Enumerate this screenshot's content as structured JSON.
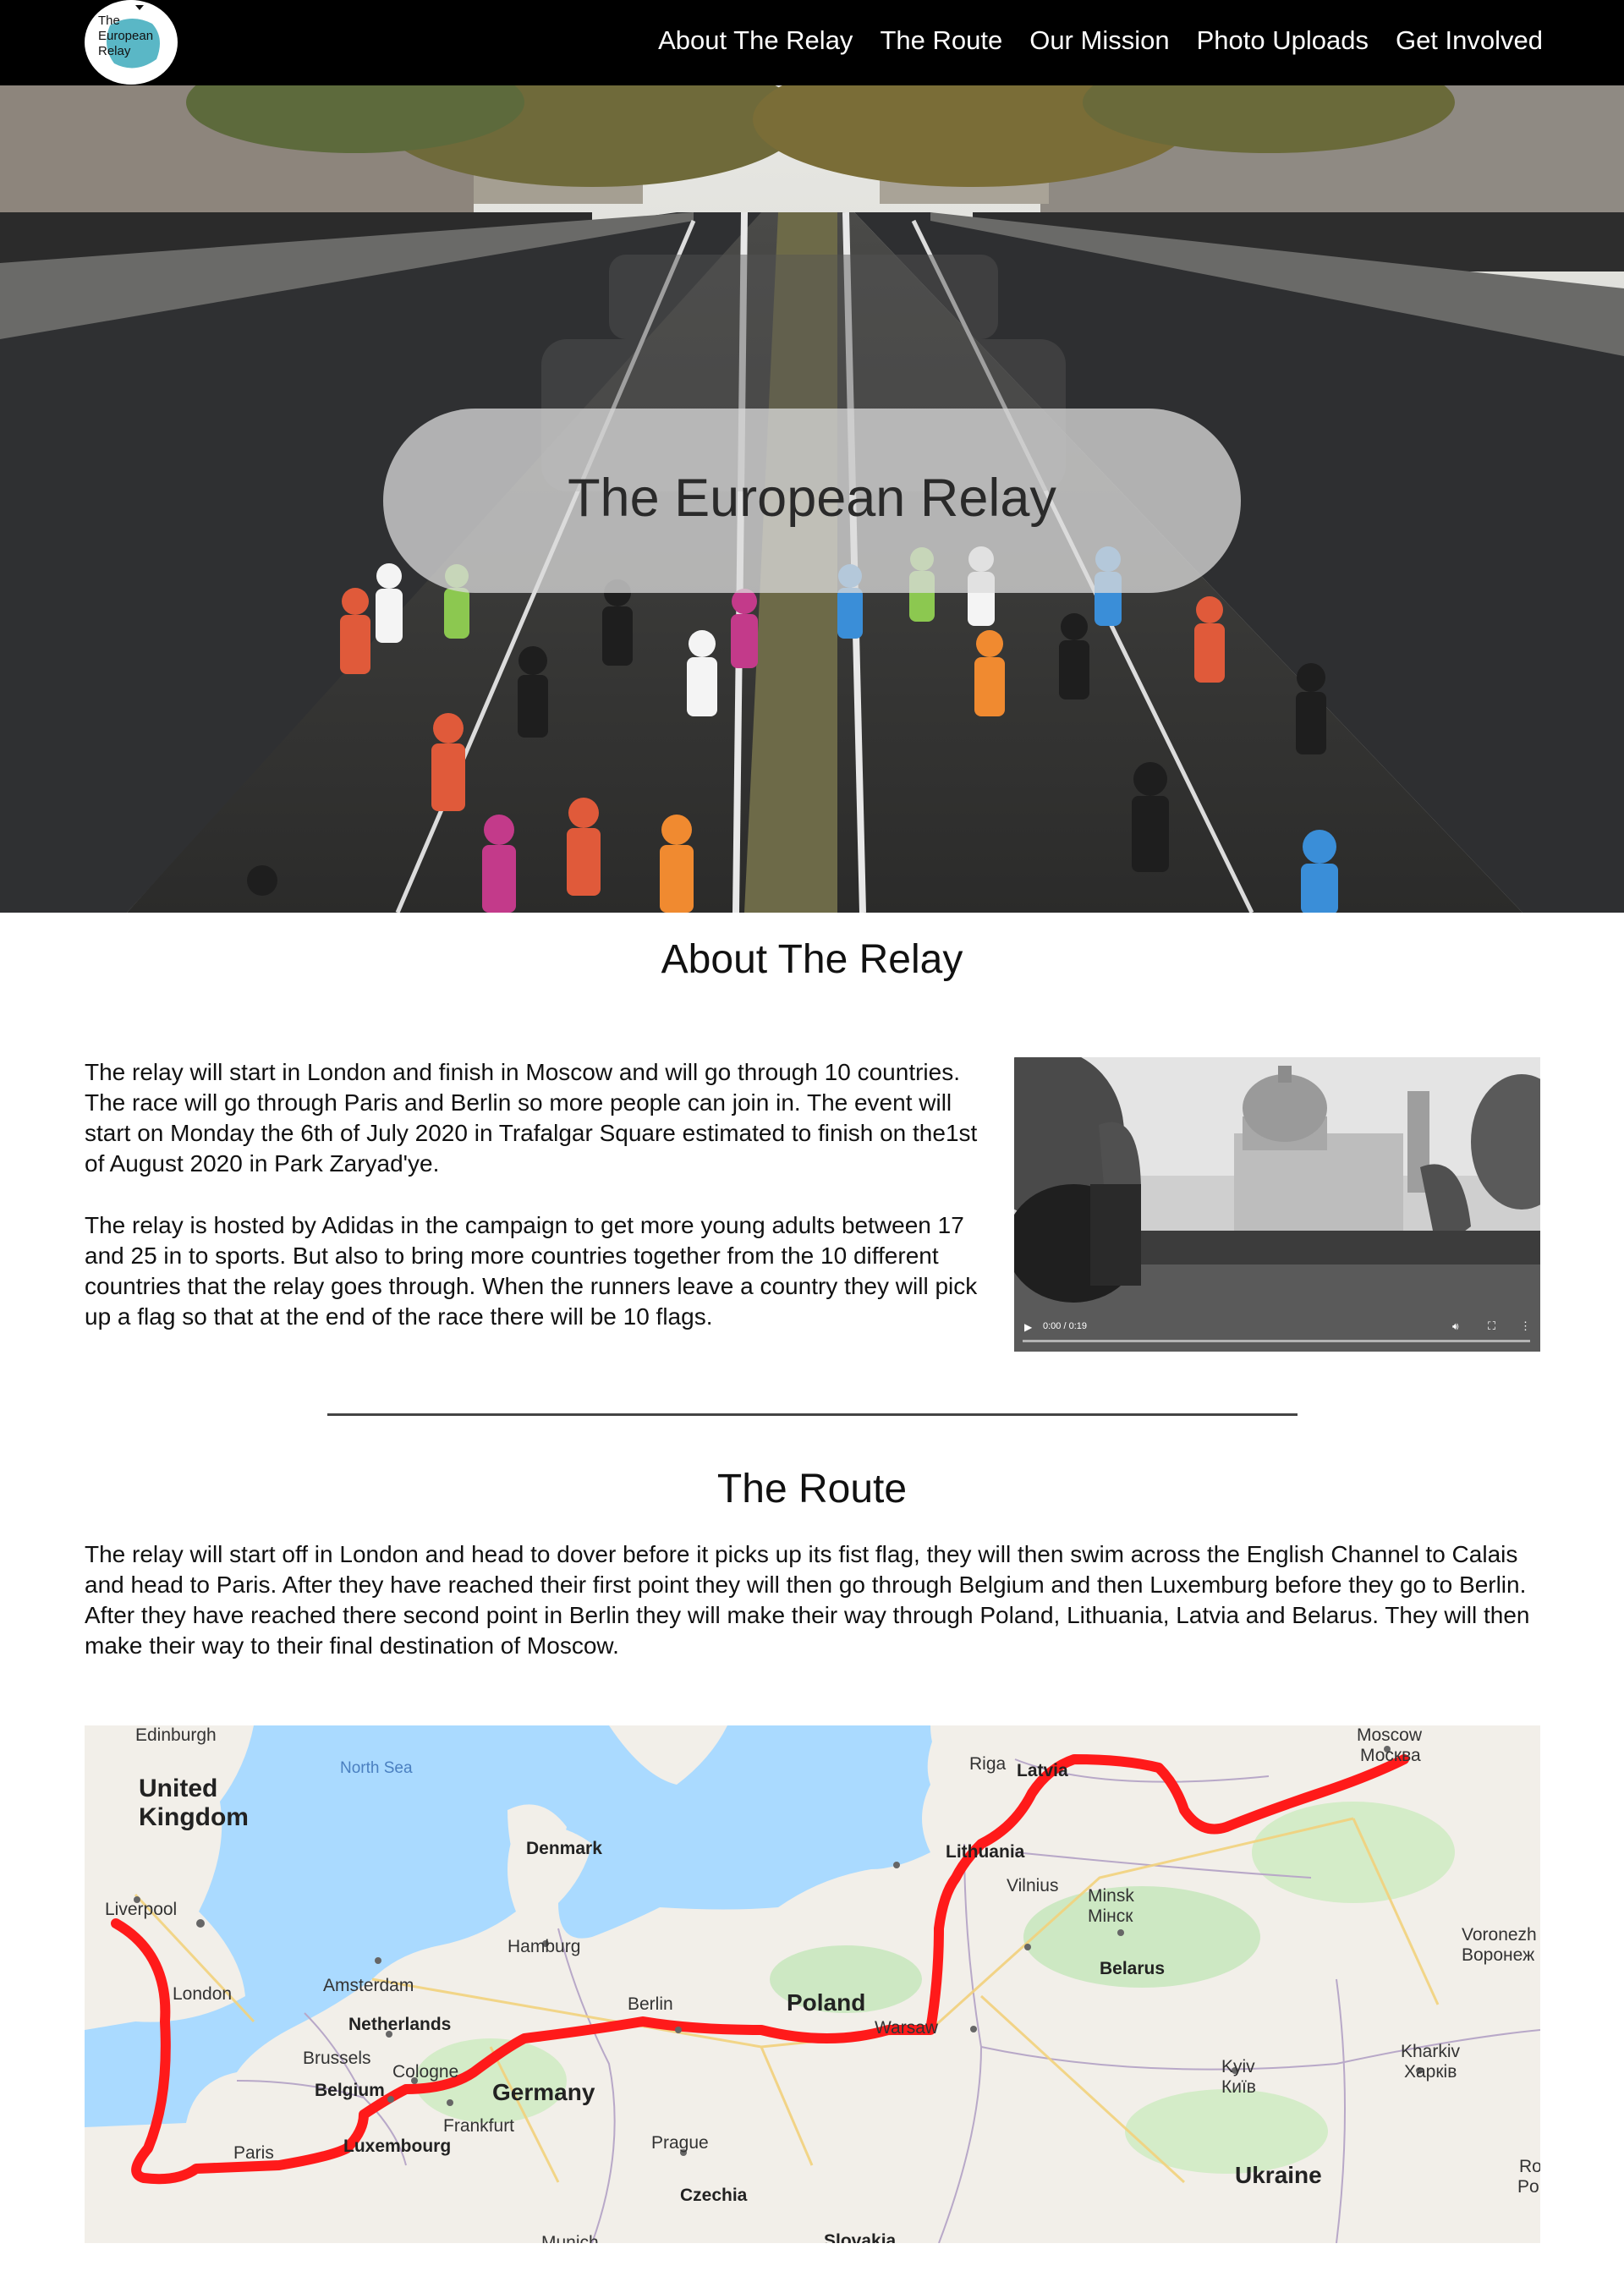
{
  "nav": {
    "logo_text": "The European Relay",
    "links": [
      "About The Relay",
      "The Route",
      "Our Mission",
      "Photo Uploads",
      "Get Involved"
    ]
  },
  "hero": {
    "title": "The European Relay"
  },
  "about": {
    "heading": "About The Relay",
    "paragraph1": "The relay will start in London and finish in Moscow and will go through 10 countries. The race will go through Paris and Berlin so more people can join in. The event will start on Monday the 6th of July 2020 in Trafalgar Square estimated to finish on the1st of August 2020 in Park Zaryad'ye.",
    "paragraph2": "The relay is hosted by Adidas in the campaign to get more young adults between 17 and 25 in to sports. But also to bring more countries together from the 10 different countries that the relay goes through. When the runners leave a country  they will pick up a flag so that at the end of the race there will be 10 flags.",
    "video": {
      "time": "0:00 / 0:19"
    }
  },
  "route": {
    "heading": "The Route",
    "paragraph": "The relay will start off in London and head to dover before it picks up its fist flag, they will then swim across the English Channel to Calais and head to Paris. After they have reached their first point they will then go through Belgium and then Luxemburg before they go to Berlin. After they have reached there second point in Berlin they will make their way through Poland, Lithuania, Latvia and Belarus. They will then make their way to their final destination of Moscow."
  },
  "map": {
    "labels": {
      "edinburgh": "Edinburgh",
      "uk": "United\nKingdom",
      "north_sea": "North Sea",
      "liverpool": "Liverpool",
      "london": "London",
      "denmark": "Denmark",
      "hamburg": "Hamburg",
      "amsterdam": "Amsterdam",
      "netherlands": "Netherlands",
      "brussels": "Brussels",
      "belgium": "Belgium",
      "cologne": "Cologne",
      "germany": "Germany",
      "frankfurt": "Frankfurt",
      "luxembourg": "Luxembourg",
      "paris": "Paris",
      "berlin": "Berlin",
      "prague": "Prague",
      "czechia": "Czechia",
      "poland": "Poland",
      "warsaw": "Warsaw",
      "riga": "Riga",
      "latvia": "Latvia",
      "lithuania": "Lithuania",
      "vilnius": "Vilnius",
      "minsk": "Minsk",
      "minsk_cyr": "Мінск",
      "belarus": "Belarus",
      "moscow": "Moscow",
      "moscow_cyr": "Москва",
      "voronezh": "Voronezh",
      "voronezh_cyr": "Воронеж",
      "kyiv": "Kyiv",
      "kyiv_cyr": "Київ",
      "kharkiv": "Kharkiv",
      "kharkiv_cyr": "Харків",
      "ukraine": "Ukraine",
      "slovakia": "Slovakia",
      "munich": "Munich",
      "ro": "Ro",
      "po": "Po"
    },
    "route_color": "#ff1a1a"
  },
  "colors": {
    "nav_bg": "#000000",
    "accent": "#ff1a1a"
  }
}
